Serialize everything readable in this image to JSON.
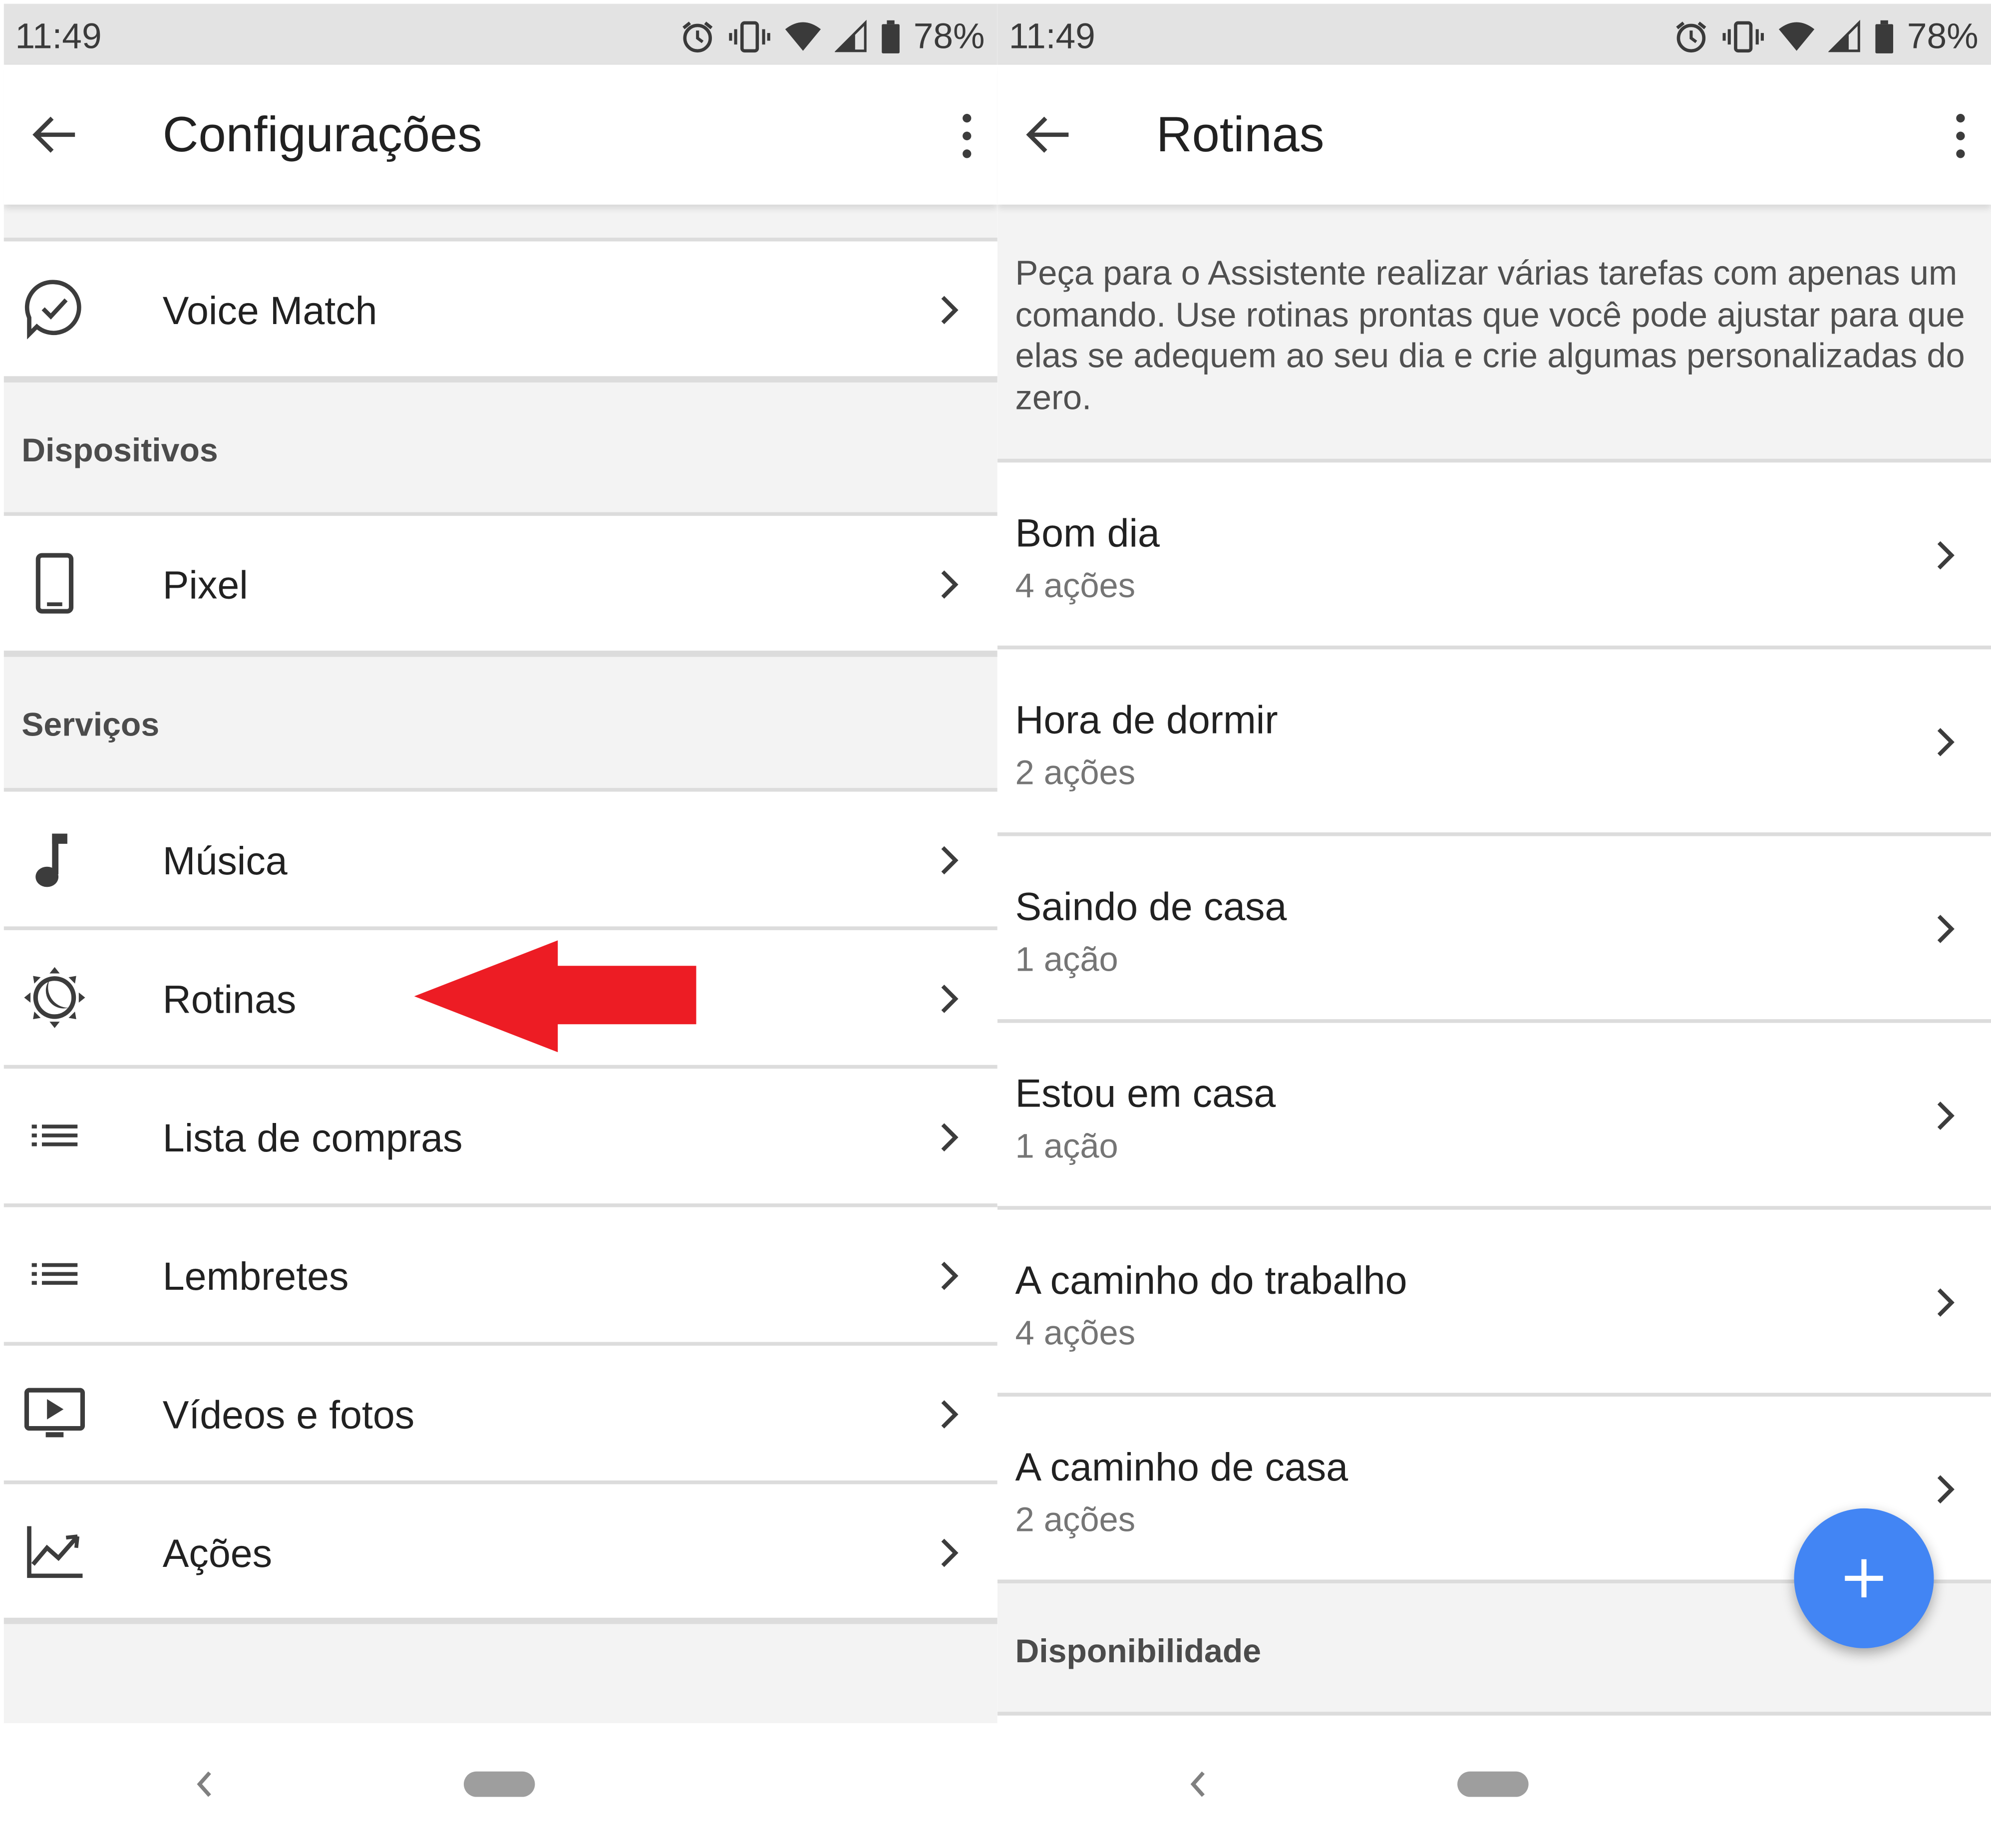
{
  "colors": {
    "accent": "#4285f4",
    "arrow": "#ed1c24",
    "statusbar": "#e3e3e3",
    "section": "#f3f3f3"
  },
  "left": {
    "status": {
      "time": "11:49",
      "battery": "78%"
    },
    "toolbar": {
      "title": "Configurações"
    },
    "rows": [
      {
        "label": "Voice Match",
        "icon": "voice-match-icon"
      },
      {
        "label": "Pixel",
        "icon": "phone-icon"
      },
      {
        "label": "Música",
        "icon": "music-note-icon"
      },
      {
        "label": "Rotinas",
        "icon": "routines-icon"
      },
      {
        "label": "Lista de compras",
        "icon": "list-icon"
      },
      {
        "label": "Lembretes",
        "icon": "list-icon"
      },
      {
        "label": "Vídeos e fotos",
        "icon": "video-icon"
      },
      {
        "label": "Ações",
        "icon": "stocks-chart-icon"
      }
    ],
    "sections": {
      "devices": "Dispositivos",
      "services": "Serviços"
    }
  },
  "right": {
    "status": {
      "time": "11:49",
      "battery": "78%"
    },
    "toolbar": {
      "title": "Rotinas"
    },
    "intro": "Peça para o Assistente realizar várias tarefas com apenas um comando. Use rotinas prontas que você pode ajustar para que elas se adequem ao seu dia e crie algumas personalizadas do zero.",
    "routines": [
      {
        "title": "Bom dia",
        "subtitle": "4 ações"
      },
      {
        "title": "Hora de dormir",
        "subtitle": "2 ações"
      },
      {
        "title": "Saindo de casa",
        "subtitle": "1 ação"
      },
      {
        "title": "Estou em casa",
        "subtitle": "1 ação"
      },
      {
        "title": "A caminho do trabalho",
        "subtitle": "4 ações"
      },
      {
        "title": "A caminho de casa",
        "subtitle": "2 ações"
      }
    ],
    "section": "Disponibilidade"
  }
}
